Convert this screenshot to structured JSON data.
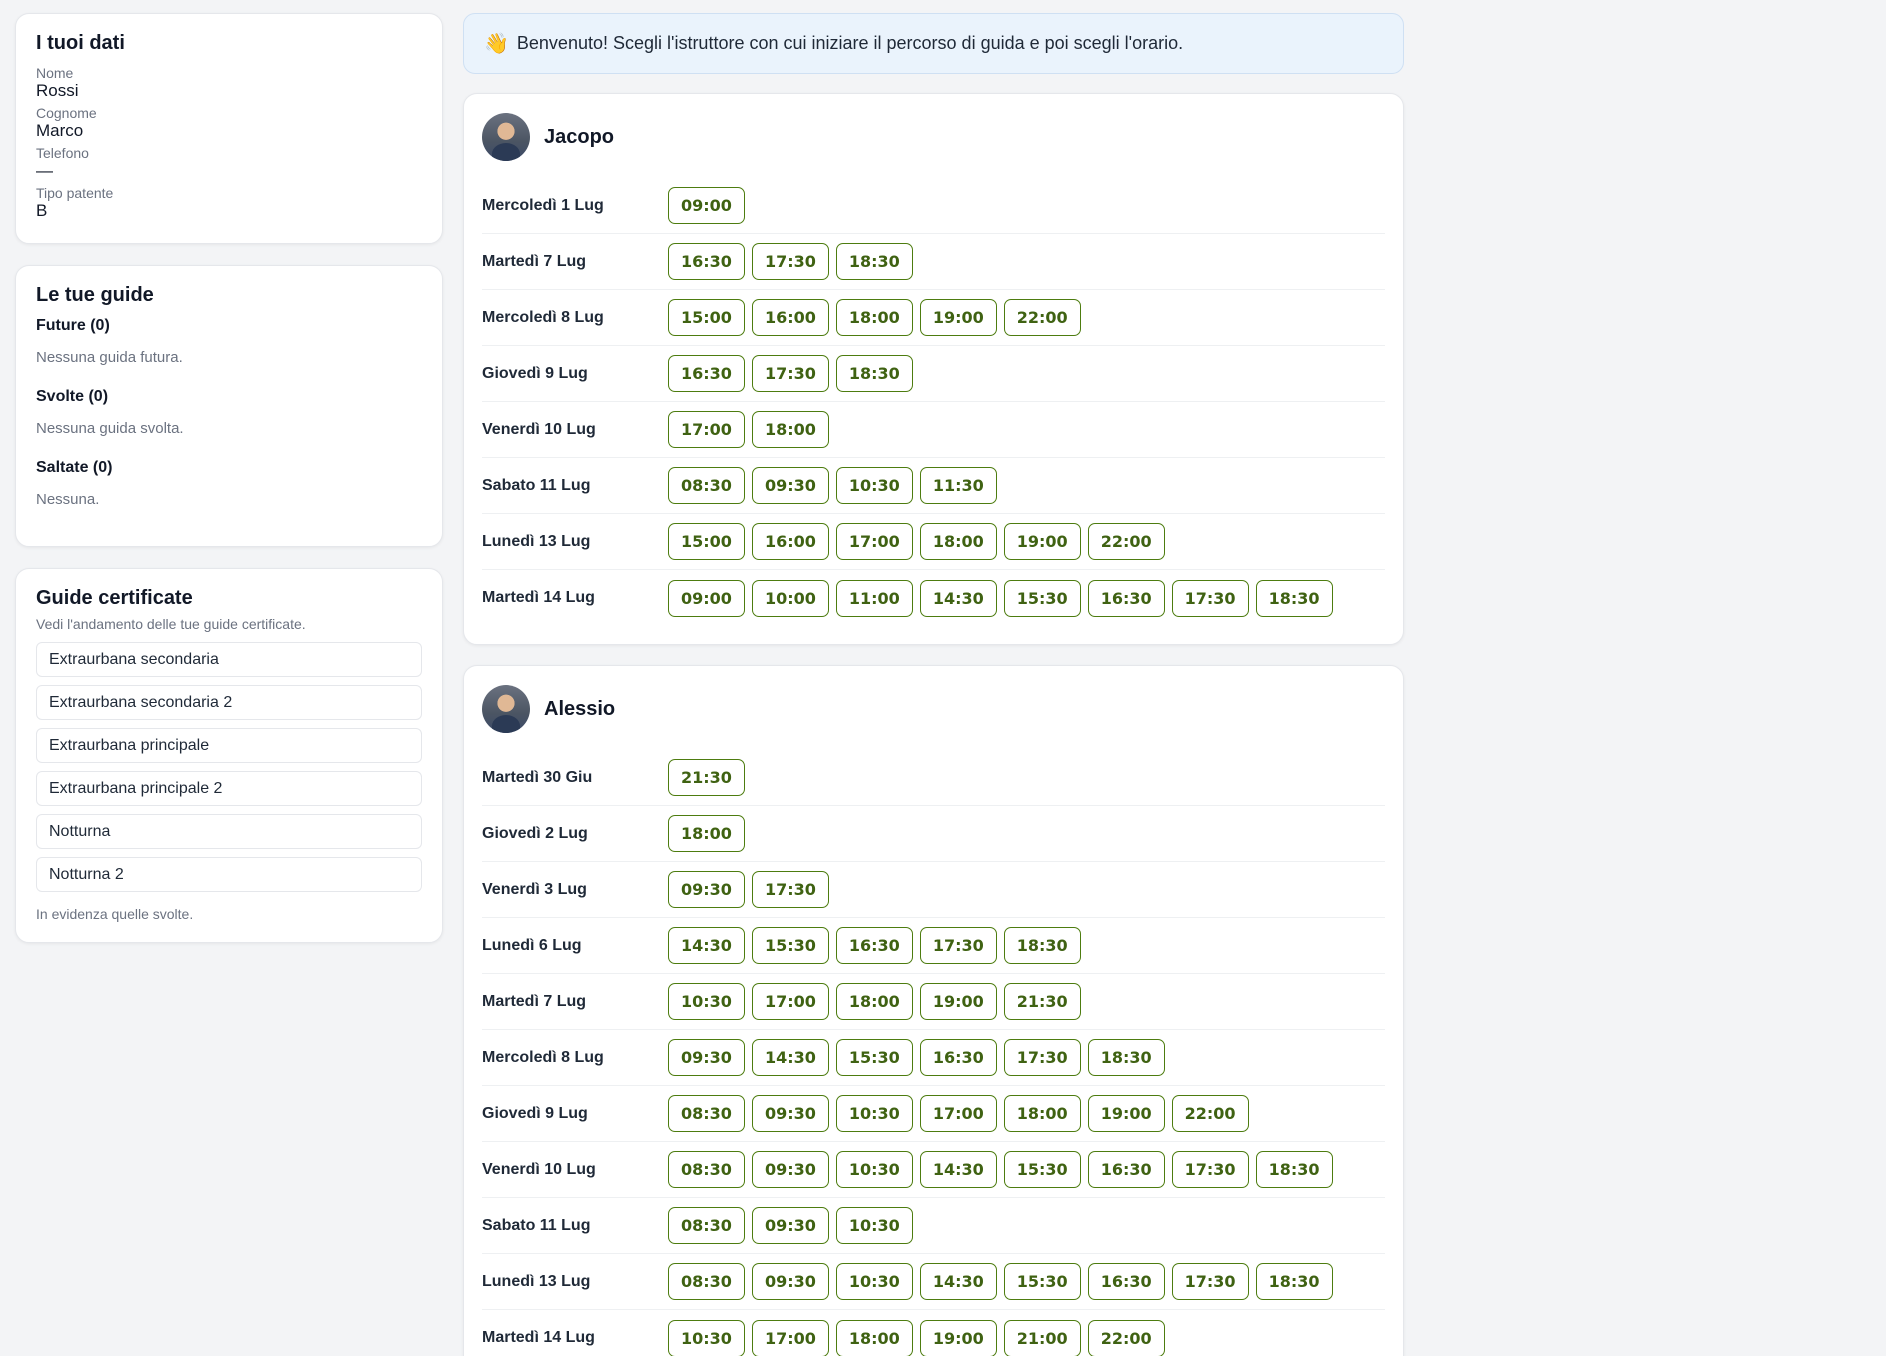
{
  "profile": {
    "title": "I tuoi dati",
    "fields": [
      {
        "label": "Nome",
        "value": "Rossi"
      },
      {
        "label": "Cognome",
        "value": "Marco"
      },
      {
        "label": "Telefono",
        "value": "—"
      },
      {
        "label": "Tipo patente",
        "value": "B"
      }
    ]
  },
  "lessons": {
    "title": "Le tue guide",
    "future_head": "Future (0)",
    "future_empty": "Nessuna guida futura.",
    "done_head": "Svolte (0)",
    "done_empty": "Nessuna guida svolta.",
    "missed_head": "Saltate (0)",
    "missed_empty": "Nessuna."
  },
  "certified": {
    "title": "Guide certificate",
    "description": "Vedi l'andamento delle tue guide certificate.",
    "items": [
      "Extraurbana secondaria",
      "Extraurbana secondaria 2",
      "Extraurbana principale",
      "Extraurbana principale 2",
      "Notturna",
      "Notturna 2"
    ],
    "note": "In evidenza quelle svolte."
  },
  "banner": {
    "emoji": "👋",
    "text": "Benvenuto! Scegli l'istruttore con cui iniziare il percorso di guida e poi scegli l'orario."
  },
  "instructors": [
    {
      "name": "Jacopo",
      "days": [
        {
          "label": "Mercoledì 1 Lug",
          "slots": [
            "09:00"
          ]
        },
        {
          "label": "Martedì 7 Lug",
          "slots": [
            "16:30",
            "17:30",
            "18:30"
          ]
        },
        {
          "label": "Mercoledì 8 Lug",
          "slots": [
            "15:00",
            "16:00",
            "18:00",
            "19:00",
            "22:00"
          ]
        },
        {
          "label": "Giovedì 9 Lug",
          "slots": [
            "16:30",
            "17:30",
            "18:30"
          ]
        },
        {
          "label": "Venerdì 10 Lug",
          "slots": [
            "17:00",
            "18:00"
          ]
        },
        {
          "label": "Sabato 11 Lug",
          "slots": [
            "08:30",
            "09:30",
            "10:30",
            "11:30"
          ]
        },
        {
          "label": "Lunedì 13 Lug",
          "slots": [
            "15:00",
            "16:00",
            "17:00",
            "18:00",
            "19:00",
            "22:00"
          ]
        },
        {
          "label": "Martedì 14 Lug",
          "slots": [
            "09:00",
            "10:00",
            "11:00",
            "14:30",
            "15:30",
            "16:30",
            "17:30",
            "18:30"
          ]
        }
      ]
    },
    {
      "name": "Alessio",
      "days": [
        {
          "label": "Martedì 30 Giu",
          "slots": [
            "21:30"
          ]
        },
        {
          "label": "Giovedì 2 Lug",
          "slots": [
            "18:00"
          ]
        },
        {
          "label": "Venerdì 3 Lug",
          "slots": [
            "09:30",
            "17:30"
          ]
        },
        {
          "label": "Lunedì 6 Lug",
          "slots": [
            "14:30",
            "15:30",
            "16:30",
            "17:30",
            "18:30"
          ]
        },
        {
          "label": "Martedì 7 Lug",
          "slots": [
            "10:30",
            "17:00",
            "18:00",
            "19:00",
            "21:30"
          ]
        },
        {
          "label": "Mercoledì 8 Lug",
          "slots": [
            "09:30",
            "14:30",
            "15:30",
            "16:30",
            "17:30",
            "18:30"
          ]
        },
        {
          "label": "Giovedì 9 Lug",
          "slots": [
            "08:30",
            "09:30",
            "10:30",
            "17:00",
            "18:00",
            "19:00",
            "22:00"
          ]
        },
        {
          "label": "Venerdì 10 Lug",
          "slots": [
            "08:30",
            "09:30",
            "10:30",
            "14:30",
            "15:30",
            "16:30",
            "17:30",
            "18:30"
          ]
        },
        {
          "label": "Sabato 11 Lug",
          "slots": [
            "08:30",
            "09:30",
            "10:30"
          ]
        },
        {
          "label": "Lunedì 13 Lug",
          "slots": [
            "08:30",
            "09:30",
            "10:30",
            "14:30",
            "15:30",
            "16:30",
            "17:30",
            "18:30"
          ]
        },
        {
          "label": "Martedì 14 Lug",
          "slots": [
            "10:30",
            "17:00",
            "18:00",
            "19:00",
            "21:00",
            "22:00"
          ]
        }
      ]
    }
  ]
}
